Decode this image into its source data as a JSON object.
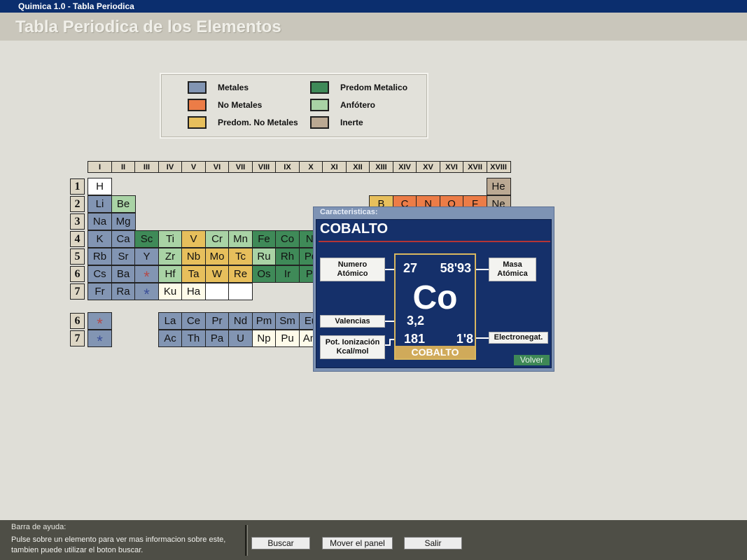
{
  "window": {
    "title": "Quimica 1.0 - Tabla Periodica"
  },
  "header": {
    "title": "Tabla Periodica de los Elementos"
  },
  "colors": {
    "metal": "#8295b3",
    "nonmetal": "#ec7c47",
    "predom_nonmetal": "#e7bf5c",
    "predom_metal": "#3f8a58",
    "amphoteric": "#a9d3a5",
    "inert": "#bba993",
    "undefined": "#ffffff",
    "pending": "#fefbe9"
  },
  "legend": [
    {
      "label": "Metales",
      "color": "#8295b3"
    },
    {
      "label": "No Metales",
      "color": "#ec7c47"
    },
    {
      "label": "Predom. No Metales",
      "color": "#e7bf5c"
    },
    {
      "label": "Predom Metalico",
      "color": "#3f8a58"
    },
    {
      "label": "Anfótero",
      "color": "#a9d3a5"
    },
    {
      "label": "Inerte",
      "color": "#bba993"
    }
  ],
  "groups": [
    "I",
    "II",
    "III",
    "IV",
    "V",
    "VI",
    "VII",
    "VIII",
    "IX",
    "X",
    "XI",
    "XII",
    "XIII",
    "XIV",
    "XV",
    "XVI",
    "XVII",
    "XVIII"
  ],
  "periods": [
    "1",
    "2",
    "3",
    "4",
    "5",
    "6",
    "7"
  ],
  "series_periods": [
    "6",
    "7"
  ],
  "elements": [
    {
      "s": "H",
      "col": 1,
      "row": 1,
      "type": "undefined"
    },
    {
      "s": "He",
      "col": 18,
      "row": 1,
      "type": "inert"
    },
    {
      "s": "Li",
      "col": 1,
      "row": 2,
      "type": "metal"
    },
    {
      "s": "Be",
      "col": 2,
      "row": 2,
      "type": "amphoteric"
    },
    {
      "s": "B",
      "col": 13,
      "row": 2,
      "type": "predom_nonmetal"
    },
    {
      "s": "C",
      "col": 14,
      "row": 2,
      "type": "nonmetal"
    },
    {
      "s": "N",
      "col": 15,
      "row": 2,
      "type": "nonmetal"
    },
    {
      "s": "O",
      "col": 16,
      "row": 2,
      "type": "nonmetal"
    },
    {
      "s": "F",
      "col": 17,
      "row": 2,
      "type": "nonmetal"
    },
    {
      "s": "Ne",
      "col": 18,
      "row": 2,
      "type": "inert"
    },
    {
      "s": "Na",
      "col": 1,
      "row": 3,
      "type": "metal"
    },
    {
      "s": "Mg",
      "col": 2,
      "row": 3,
      "type": "metal"
    },
    {
      "s": "K",
      "col": 1,
      "row": 4,
      "type": "metal"
    },
    {
      "s": "Ca",
      "col": 2,
      "row": 4,
      "type": "metal"
    },
    {
      "s": "Sc",
      "col": 3,
      "row": 4,
      "type": "predom_metal"
    },
    {
      "s": "Ti",
      "col": 4,
      "row": 4,
      "type": "amphoteric"
    },
    {
      "s": "V",
      "col": 5,
      "row": 4,
      "type": "predom_nonmetal"
    },
    {
      "s": "Cr",
      "col": 6,
      "row": 4,
      "type": "amphoteric"
    },
    {
      "s": "Mn",
      "col": 7,
      "row": 4,
      "type": "amphoteric"
    },
    {
      "s": "Fe",
      "col": 8,
      "row": 4,
      "type": "predom_metal"
    },
    {
      "s": "Co",
      "col": 9,
      "row": 4,
      "type": "predom_metal"
    },
    {
      "s": "Ni",
      "col": 10,
      "row": 4,
      "type": "predom_metal"
    },
    {
      "s": "Rb",
      "col": 1,
      "row": 5,
      "type": "metal"
    },
    {
      "s": "Sr",
      "col": 2,
      "row": 5,
      "type": "metal"
    },
    {
      "s": "Y",
      "col": 3,
      "row": 5,
      "type": "metal"
    },
    {
      "s": "Zr",
      "col": 4,
      "row": 5,
      "type": "amphoteric"
    },
    {
      "s": "Nb",
      "col": 5,
      "row": 5,
      "type": "predom_nonmetal"
    },
    {
      "s": "Mo",
      "col": 6,
      "row": 5,
      "type": "predom_nonmetal"
    },
    {
      "s": "Tc",
      "col": 7,
      "row": 5,
      "type": "predom_nonmetal"
    },
    {
      "s": "Ru",
      "col": 8,
      "row": 5,
      "type": "amphoteric"
    },
    {
      "s": "Rh",
      "col": 9,
      "row": 5,
      "type": "predom_metal"
    },
    {
      "s": "Pd",
      "col": 10,
      "row": 5,
      "type": "predom_metal"
    },
    {
      "s": "Cs",
      "col": 1,
      "row": 6,
      "type": "metal"
    },
    {
      "s": "Ba",
      "col": 2,
      "row": 6,
      "type": "metal"
    },
    {
      "s": "*",
      "col": 3,
      "row": 6,
      "type": "metal",
      "star": "#b34a4a"
    },
    {
      "s": "Hf",
      "col": 4,
      "row": 6,
      "type": "amphoteric"
    },
    {
      "s": "Ta",
      "col": 5,
      "row": 6,
      "type": "predom_nonmetal"
    },
    {
      "s": "W",
      "col": 6,
      "row": 6,
      "type": "predom_nonmetal"
    },
    {
      "s": "Re",
      "col": 7,
      "row": 6,
      "type": "predom_nonmetal"
    },
    {
      "s": "Os",
      "col": 8,
      "row": 6,
      "type": "predom_metal"
    },
    {
      "s": "Ir",
      "col": 9,
      "row": 6,
      "type": "predom_metal"
    },
    {
      "s": "Pt",
      "col": 10,
      "row": 6,
      "type": "predom_metal"
    },
    {
      "s": "Fr",
      "col": 1,
      "row": 7,
      "type": "metal"
    },
    {
      "s": "Ra",
      "col": 2,
      "row": 7,
      "type": "metal"
    },
    {
      "s": "*",
      "col": 3,
      "row": 7,
      "type": "metal",
      "star": "#3b4f98"
    },
    {
      "s": "Ku",
      "col": 4,
      "row": 7,
      "type": "pending"
    },
    {
      "s": "Ha",
      "col": 5,
      "row": 7,
      "type": "pending"
    },
    {
      "s": "",
      "col": 6,
      "row": 7,
      "type": "undefined"
    },
    {
      "s": "",
      "col": 7,
      "row": 7,
      "type": "undefined"
    },
    {
      "s": "*",
      "col": 1,
      "row": 8,
      "type": "metal",
      "star": "#b34a4a"
    },
    {
      "s": "La",
      "col": 4,
      "row": 8,
      "type": "metal"
    },
    {
      "s": "Ce",
      "col": 5,
      "row": 8,
      "type": "metal"
    },
    {
      "s": "Pr",
      "col": 6,
      "row": 8,
      "type": "metal"
    },
    {
      "s": "Nd",
      "col": 7,
      "row": 8,
      "type": "metal"
    },
    {
      "s": "Pm",
      "col": 8,
      "row": 8,
      "type": "metal"
    },
    {
      "s": "Sm",
      "col": 9,
      "row": 8,
      "type": "metal"
    },
    {
      "s": "Eu",
      "col": 10,
      "row": 8,
      "type": "metal"
    },
    {
      "s": "*",
      "col": 1,
      "row": 9,
      "type": "metal",
      "star": "#3b4f98"
    },
    {
      "s": "Ac",
      "col": 4,
      "row": 9,
      "type": "metal"
    },
    {
      "s": "Th",
      "col": 5,
      "row": 9,
      "type": "metal"
    },
    {
      "s": "Pa",
      "col": 6,
      "row": 9,
      "type": "metal"
    },
    {
      "s": "U",
      "col": 7,
      "row": 9,
      "type": "metal"
    },
    {
      "s": "Np",
      "col": 8,
      "row": 9,
      "type": "pending"
    },
    {
      "s": "Pu",
      "col": 9,
      "row": 9,
      "type": "pending"
    },
    {
      "s": "Am",
      "col": 10,
      "row": 9,
      "type": "pending"
    }
  ],
  "panel": {
    "caption": "Caracteristicas:",
    "name": "COBALTO",
    "atomic_number": "27",
    "atomic_mass": "58'93",
    "symbol": "Co",
    "valences": "3,2",
    "ionization": "181",
    "electronegativity": "1'8",
    "card_name": "COBALTO",
    "labels": {
      "atomic_number_1": "Numero",
      "atomic_number_2": "Atómico",
      "atomic_mass_1": "Masa",
      "atomic_mass_2": "Atómica",
      "valences": "Valencias",
      "ionization_1": "Pot. Ionización",
      "ionization_2": "Kcal/mol",
      "electronegativity": "Electronegat."
    },
    "back_button": "Volver"
  },
  "helpbar": {
    "title": "Barra de ayuda:",
    "line1": "Pulse sobre un elemento para ver mas informacion sobre este,",
    "line2": "tambien puede utilizar el boton buscar."
  },
  "buttons": {
    "search": "Buscar",
    "move_panel": "Mover el panel",
    "exit": "Salir"
  }
}
